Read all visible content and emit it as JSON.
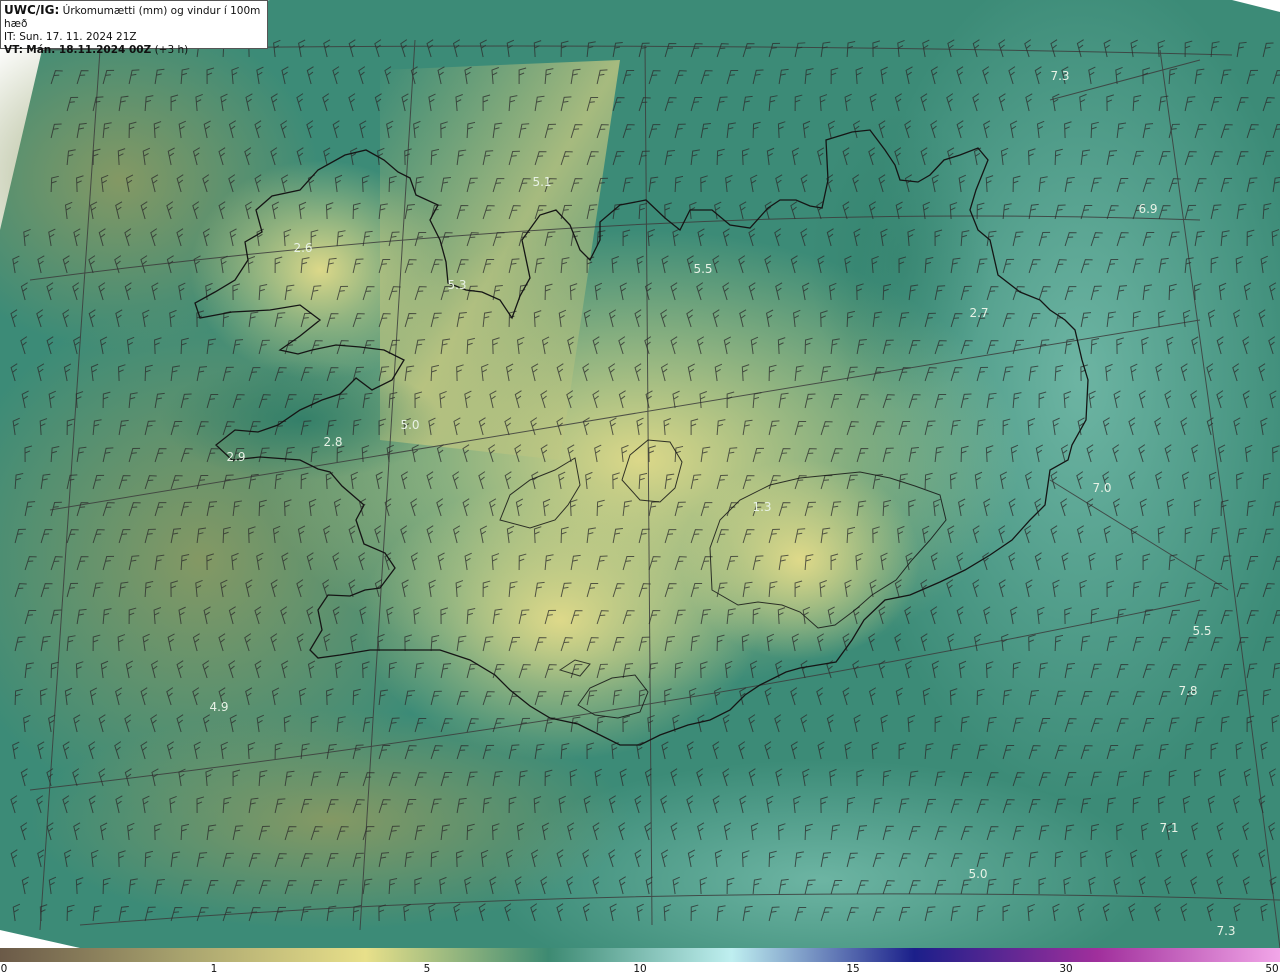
{
  "header": {
    "product_code": "UWC/IG:",
    "title": "Úrkomumætti (mm) og vindur í 100m hæð",
    "issue_time": "IT: Sun. 17. 11. 2024 21Z",
    "valid_prefix": "VT:",
    "valid_time": "Mán. 18.11.2024 00Z",
    "lead_time": "(+3 h)"
  },
  "map_labels": [
    {
      "text": "7.3"
    },
    {
      "text": "5.1"
    },
    {
      "text": "6.9"
    },
    {
      "text": "2.6"
    },
    {
      "text": "5.3"
    },
    {
      "text": "5.5"
    },
    {
      "text": "2.7"
    },
    {
      "text": "5.0"
    },
    {
      "text": "2.8"
    },
    {
      "text": "2.9"
    },
    {
      "text": "7.0"
    },
    {
      "text": "1.3"
    },
    {
      "text": "5.5"
    },
    {
      "text": "7.8"
    },
    {
      "text": "4.9"
    },
    {
      "text": "7.1"
    },
    {
      "text": "5.0"
    },
    {
      "text": "7.3"
    }
  ],
  "colorbar": {
    "ticks": [
      {
        "label": "0",
        "value": 0
      },
      {
        "label": "1",
        "value": 1
      },
      {
        "label": "5",
        "value": 5
      },
      {
        "label": "10",
        "value": 10
      },
      {
        "label": "15",
        "value": 15
      },
      {
        "label": "30",
        "value": 30
      },
      {
        "label": "50",
        "value": 50
      }
    ],
    "colors": [
      "#6b5a48",
      "#a8a36e",
      "#e8e08a",
      "#3d8a72",
      "#bfeff0",
      "#1b1f8a",
      "#a02f9c",
      "#f2a6e8"
    ]
  },
  "colors": {
    "sea": "#3b8a76",
    "sea_light": "#6fb7a4",
    "land_dry": "#a9b874",
    "land_wet": "#e0d985",
    "coastline": "#1a1a1a",
    "graticule": "#3c3c3c",
    "label_text": "#e8f2e6"
  }
}
